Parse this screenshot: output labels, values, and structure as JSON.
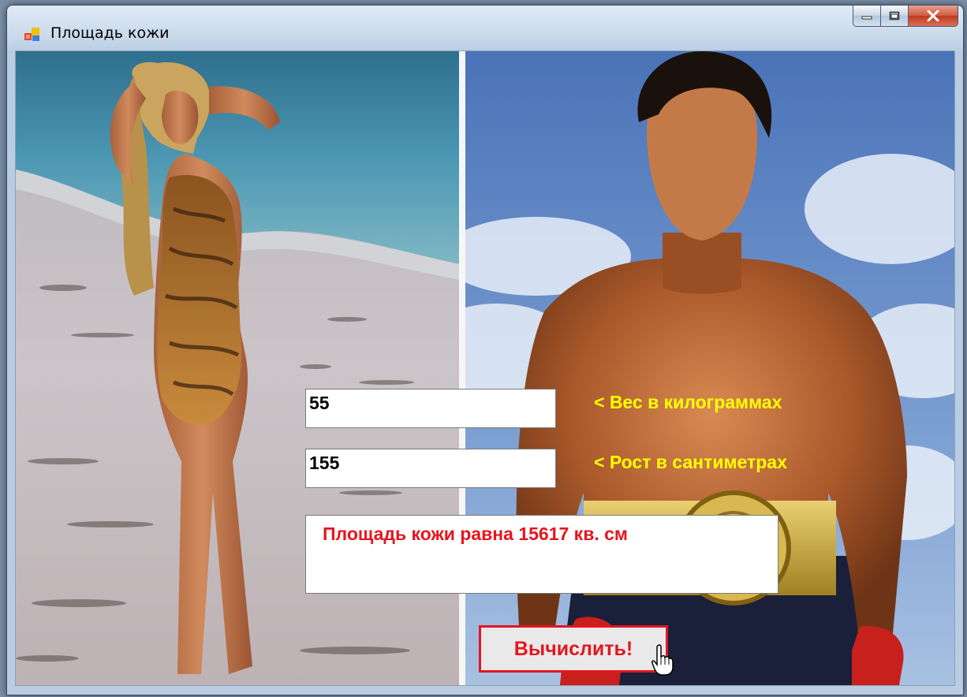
{
  "window": {
    "title": "Площадь кожи"
  },
  "form": {
    "weight_value": "55",
    "weight_label": "< Вес в килограммах",
    "height_value": "155",
    "height_label": "< Рост в сантиметрах",
    "result_text": "Площадь кожи равна 15617 кв. см",
    "calc_button_label": "Вычислить!"
  },
  "colors": {
    "label_color": "#ffff00",
    "result_color": "#e8141e",
    "button_border": "#e3161f"
  },
  "images": {
    "left": "woman-on-beach-photo",
    "right": "boxer-with-belt-photo"
  }
}
